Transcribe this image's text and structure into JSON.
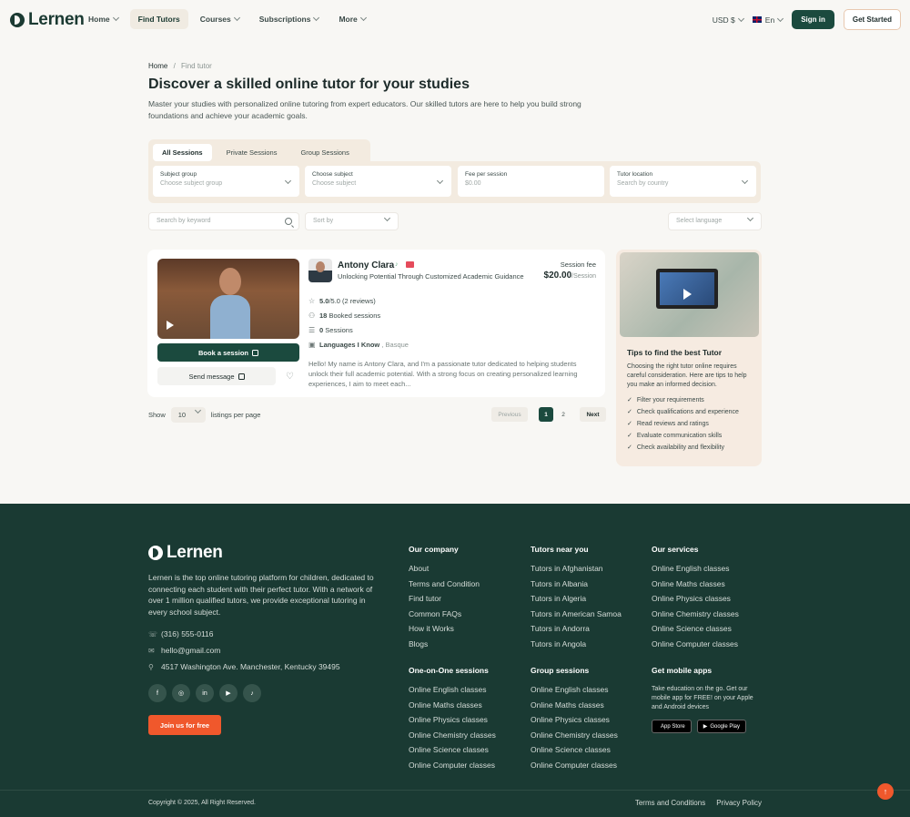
{
  "brand": {
    "name": "Lernen"
  },
  "nav": {
    "items": [
      {
        "label": "Home"
      },
      {
        "label": "Find Tutors"
      },
      {
        "label": "Courses"
      },
      {
        "label": "Subscriptions"
      },
      {
        "label": "More"
      }
    ],
    "currency": "USD $",
    "language": "En",
    "sign_in": "Sign in",
    "get_started": "Get Started"
  },
  "breadcrumb": {
    "home": "Home",
    "sep": "/",
    "current": "Find tutor"
  },
  "hero": {
    "title": "Discover a skilled online tutor for your studies",
    "description": "Master your studies with personalized online tutoring from expert educators. Our skilled tutors are here to help you build strong foundations and achieve your academic goals."
  },
  "filters": {
    "tabs": [
      {
        "label": "All Sessions"
      },
      {
        "label": "Private Sessions"
      },
      {
        "label": "Group Sessions"
      }
    ],
    "fields": [
      {
        "label": "Subject group",
        "placeholder": "Choose subject group"
      },
      {
        "label": "Choose subject",
        "placeholder": "Choose subject"
      },
      {
        "label": "Fee per session",
        "placeholder": "$0.00"
      },
      {
        "label": "Tutor location",
        "placeholder": "Search by country"
      }
    ],
    "keyword_placeholder": "Search by keyword",
    "sort_placeholder": "Sort by",
    "language_placeholder": "Select language"
  },
  "tutor": {
    "name": "Antony Clara",
    "tagline": "Unlocking Potential Through Customized Academic Guidance",
    "fee_label": "Session fee",
    "fee": "$20.00",
    "fee_unit": "/Session",
    "rating": "5.0",
    "rating_rest": "/5.0 (2 reviews)",
    "booked_count": "18",
    "booked_label": "Booked sessions",
    "sessions_count": "0",
    "sessions_label": "Sessions",
    "languages_label": "Languages I Know",
    "languages": ", Basque",
    "bio": "Hello! My name is Antony Clara, and I'm a passionate tutor dedicated to helping students unlock their full academic potential. With a strong focus on creating personalized learning experiences, I aim to meet each...",
    "book_label": "Book a session",
    "message_label": "Send message"
  },
  "pagination": {
    "show": "Show",
    "per_page": "10",
    "per_page_label": "listings per page",
    "previous": "Previous",
    "pages": [
      "1",
      "2"
    ],
    "next": "Next"
  },
  "tips": {
    "title": "Tips to find the best Tutor",
    "description": "Choosing the right tutor online requires careful consideration. Here are tips to help you make an informed decision.",
    "items": [
      "Filter your requirements",
      "Check qualifications and experience",
      "Read reviews and ratings",
      "Evaluate communication skills",
      "Check availability and flexibility"
    ]
  },
  "footer": {
    "description": "Lernen is the top online tutoring platform for children, dedicated to connecting each student with their perfect tutor. With a network of over 1 million qualified tutors, we provide exceptional tutoring in every school subject.",
    "phone": "(316) 555-0116",
    "email": "hello@gmail.com",
    "address": "4517 Washington Ave. Manchester, Kentucky 39495",
    "join": "Join us for free",
    "company": {
      "title": "Our company",
      "links": [
        "About",
        "Terms and Condition",
        "Find tutor",
        "Common FAQs",
        "How it Works",
        "Blogs"
      ]
    },
    "tutors_near": {
      "title": "Tutors near you",
      "links": [
        "Tutors in Afghanistan",
        "Tutors in Albania",
        "Tutors in Algeria",
        "Tutors in American Samoa",
        "Tutors in Andorra",
        "Tutors in Angola"
      ]
    },
    "services": {
      "title": "Our services",
      "links": [
        "Online English classes",
        "Online Maths classes",
        "Online Physics classes",
        "Online Chemistry classes",
        "Online Science classes",
        "Online Computer classes"
      ]
    },
    "one_on_one": {
      "title": "One-on-One sessions",
      "links": [
        "Online English classes",
        "Online Maths classes",
        "Online Physics classes",
        "Online Chemistry classes",
        "Online Science classes",
        "Online Computer classes"
      ]
    },
    "group": {
      "title": "Group sessions",
      "links": [
        "Online English classes",
        "Online Maths classes",
        "Online Physics classes",
        "Online Chemistry classes",
        "Online Science classes",
        "Online Computer classes"
      ]
    },
    "apps": {
      "title": "Get mobile apps",
      "description": "Take education on the go. Get our mobile app for FREE! on your Apple and Android devices",
      "app_store": "App Store",
      "google_play": "Google Play"
    },
    "copyright": "Copyright © 2025, All Right Reserved.",
    "terms": "Terms and Conditions",
    "privacy": "Privacy Policy"
  },
  "colors": {
    "accent": "#1b4a3e",
    "footer_bg": "#1a3a33",
    "cta": "#f0582c"
  }
}
